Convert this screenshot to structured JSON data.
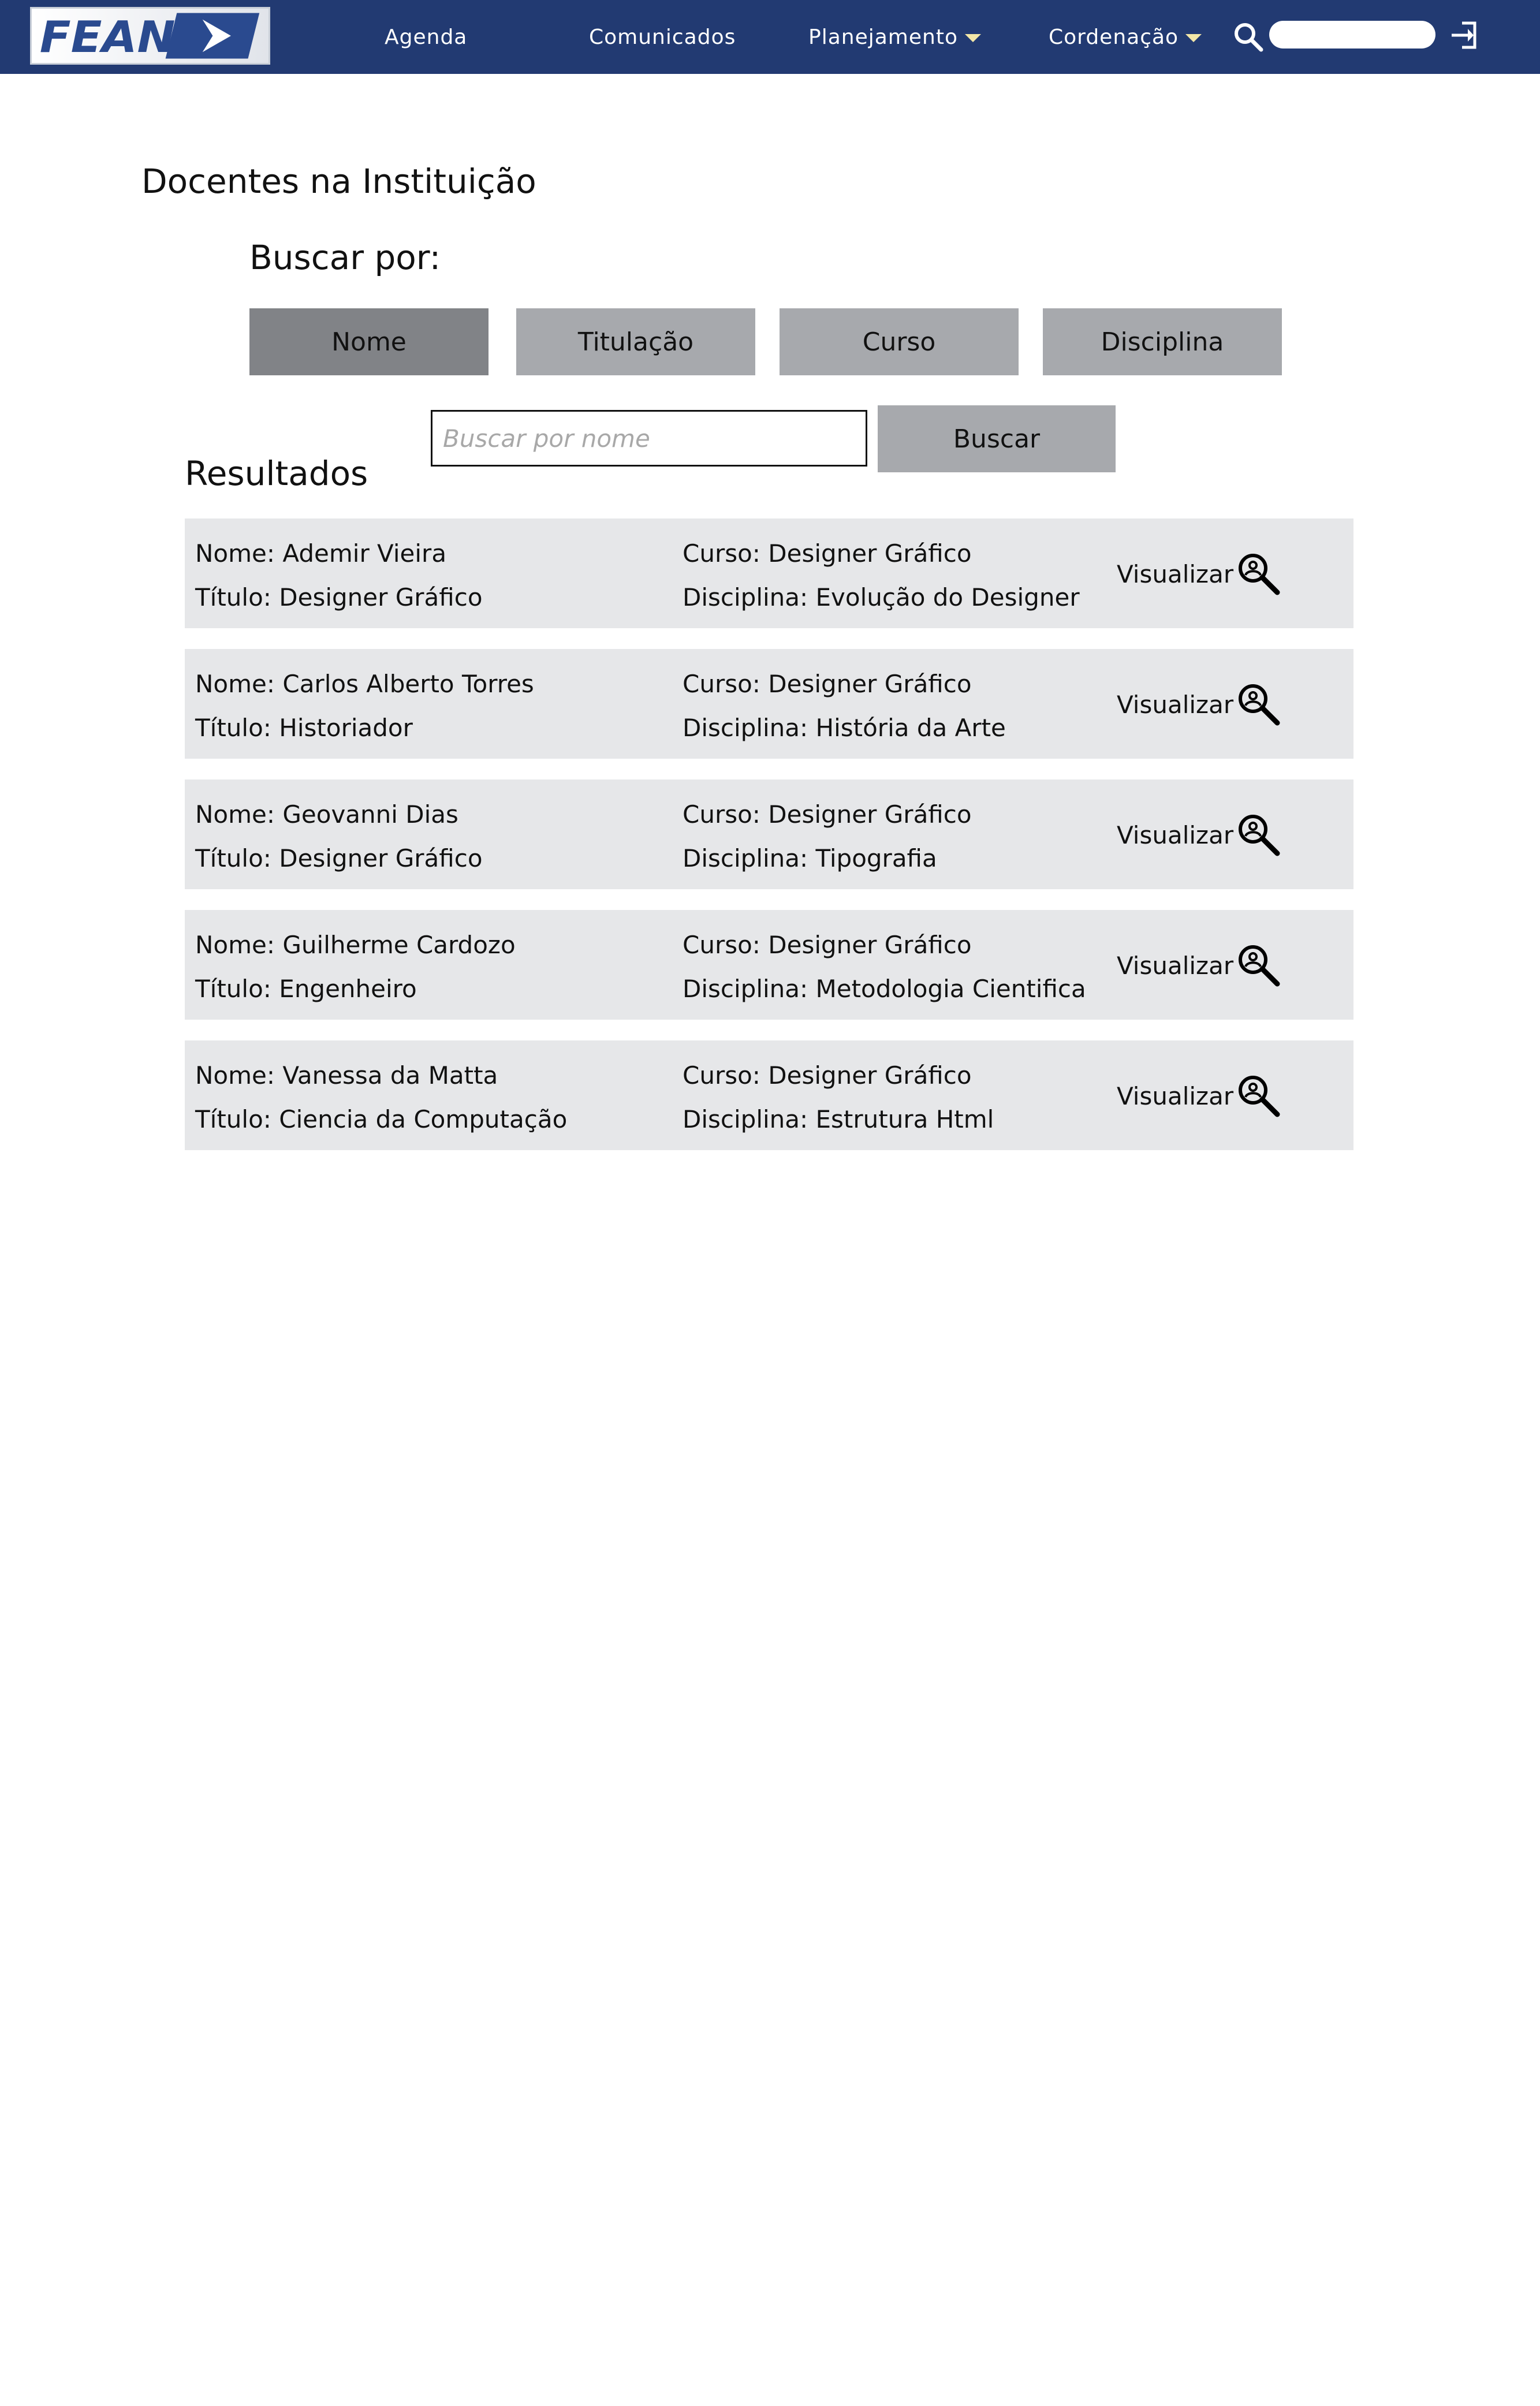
{
  "nav": {
    "logo_text": "FEAN",
    "items": [
      {
        "label": "Agenda"
      },
      {
        "label": "Comunicados"
      },
      {
        "label": "Planejamento"
      },
      {
        "label": "Cordenação"
      }
    ],
    "search_placeholder": "",
    "icons": [
      "search-icon",
      "login-icon",
      "chevron-down-icon"
    ],
    "bar_color": "#223a72"
  },
  "page": {
    "title": "Docentes na Instituição",
    "search_by_label": "Buscar por:",
    "filters": [
      {
        "label": "Nome",
        "active": true
      },
      {
        "label": "Titulação",
        "active": false
      },
      {
        "label": "Curso",
        "active": false
      },
      {
        "label": "Disciplina",
        "active": false
      }
    ],
    "search_placeholder": "Buscar por nome",
    "search_button": "Buscar",
    "results_title": "Resultados"
  },
  "results": [
    {
      "nome": "Nome: Ademir Vieira",
      "titulo": "Título: Designer Gráfico",
      "curso": "Curso: Designer Gráfico",
      "disciplina": "Disciplina: Evolução do Designer",
      "action": "Visualizar"
    },
    {
      "nome": "Nome: Carlos Alberto Torres",
      "titulo": "Título: Historiador",
      "curso": "Curso: Designer Gráfico",
      "disciplina": "Disciplina: História da Arte",
      "action": "Visualizar"
    },
    {
      "nome": "Nome: Geovanni Dias",
      "titulo": "Título: Designer Gráfico",
      "curso": "Curso: Designer Gráfico",
      "disciplina": "Disciplina: Tipografia",
      "action": "Visualizar"
    },
    {
      "nome": "Nome: Guilherme Cardozo",
      "titulo": "Título: Engenheiro",
      "curso": "Curso: Designer Gráfico",
      "disciplina": "Disciplina: Metodologia Cientifica",
      "action": "Visualizar"
    },
    {
      "nome": "Nome: Vanessa da Matta",
      "titulo": "Título: Ciencia da Computação",
      "curso": "Curso: Designer Gráfico",
      "disciplina": "Disciplina: Estrutura Html",
      "action": "Visualizar"
    }
  ]
}
